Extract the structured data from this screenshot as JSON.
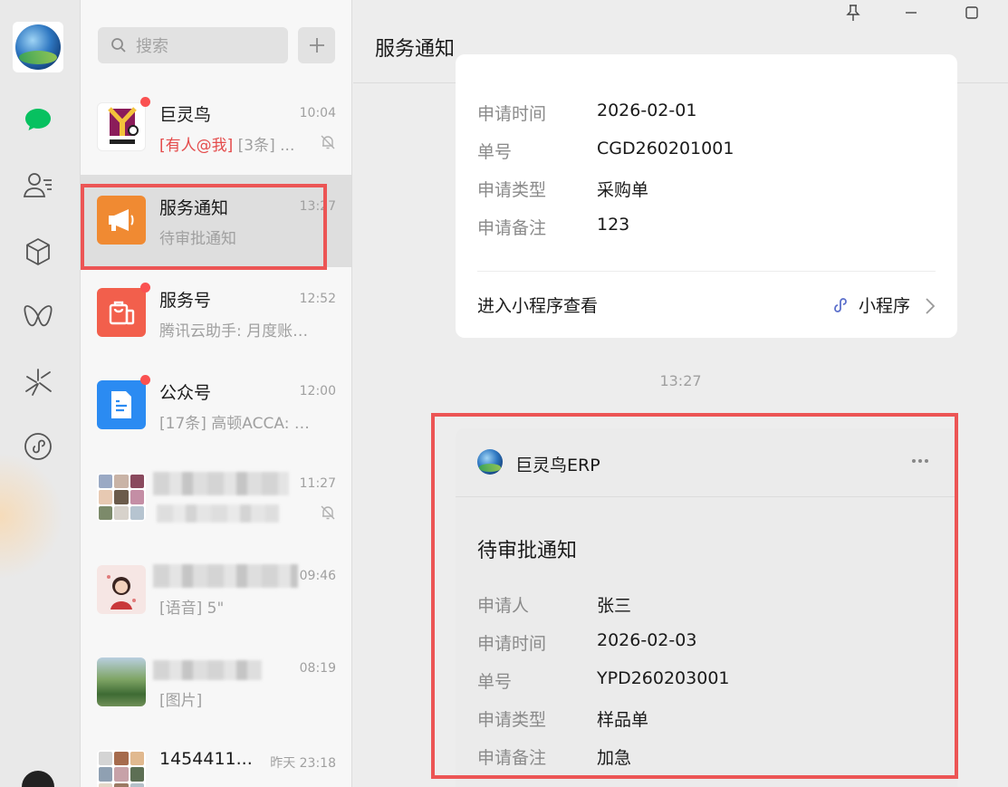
{
  "search": {
    "placeholder": "搜索"
  },
  "sidebar": {
    "icons": [
      "chat-icon",
      "contacts-icon",
      "favorites-icon",
      "channels-icon",
      "moments-icon",
      "miniprogram-icon"
    ]
  },
  "chat_list": {
    "items": [
      {
        "name": "巨灵鸟",
        "time": "10:04",
        "preview_mention": "[有人@我]",
        "preview": " [3条] ...",
        "unread": true,
        "muted": true
      },
      {
        "name": "服务通知",
        "time": "13:27",
        "preview_mention": "",
        "preview": "待审批通知",
        "unread": false,
        "muted": false
      },
      {
        "name": "服务号",
        "time": "12:52",
        "preview_mention": "",
        "preview": "腾讯云助手: 月度账单...",
        "unread": true,
        "muted": false
      },
      {
        "name": "公众号",
        "time": "12:00",
        "preview_mention": "",
        "preview": "[17条] 高顿ACCA: 【A...",
        "unread": true,
        "muted": false
      },
      {
        "name": "",
        "time": "11:27",
        "preview_mention": "",
        "preview": "",
        "unread": false,
        "muted": true
      },
      {
        "name": "",
        "time": "09:46",
        "preview_mention": "",
        "preview": "[语音] 5\"",
        "unread": false,
        "muted": false
      },
      {
        "name": "",
        "time": "08:19",
        "preview_mention": "",
        "preview": "[图片]",
        "unread": false,
        "muted": false
      },
      {
        "name": "1454411...",
        "time": "昨天 23:18",
        "preview_mention": "",
        "preview": "",
        "unread": false,
        "muted": true
      }
    ]
  },
  "chat": {
    "title": "服务通知",
    "card1": {
      "rows": [
        {
          "key": "申请时间",
          "value": "2026-02-01"
        },
        {
          "key": "单号",
          "value": "CGD260201001"
        },
        {
          "key": "申请类型",
          "value": "采购单"
        },
        {
          "key": "申请备注",
          "value": "123"
        }
      ],
      "enter_label": "进入小程序查看",
      "mini_program_label": "小程序"
    },
    "timestamp": "13:27",
    "card2": {
      "sender": "巨灵鸟ERP",
      "headline": "待审批通知",
      "rows": [
        {
          "key": "申请人",
          "value": "张三"
        },
        {
          "key": "申请时间",
          "value": "2026-02-03"
        },
        {
          "key": "单号",
          "value": "YPD260203001"
        },
        {
          "key": "申请类型",
          "value": "样品单"
        },
        {
          "key": "申请备注",
          "value": "加急"
        }
      ]
    }
  },
  "colors": {
    "accent_green": "#07c160",
    "highlight_red": "#ec5555",
    "unread_dot": "#fa5151",
    "mention_red": "#e44c4c"
  }
}
